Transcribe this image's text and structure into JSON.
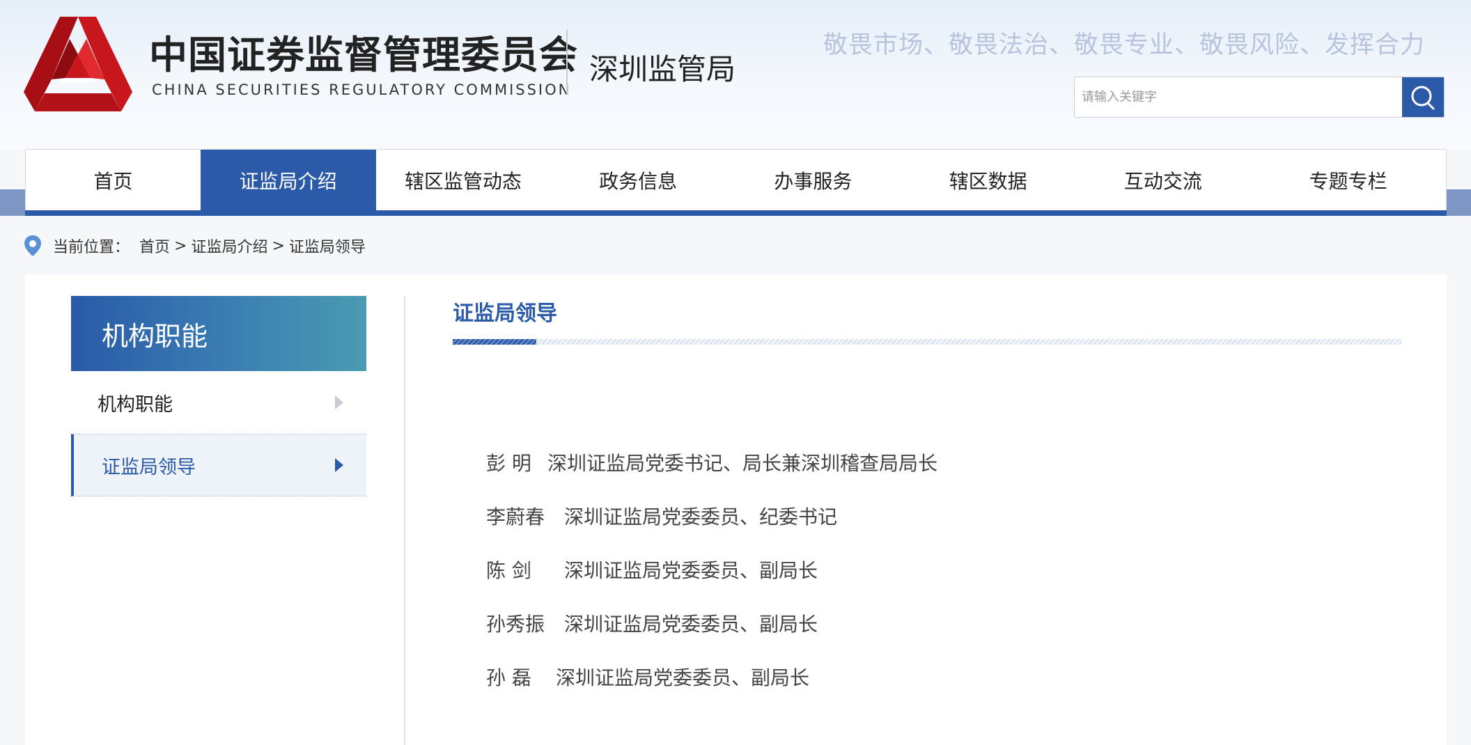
{
  "header": {
    "logo_cn": "中国证券监督管理委员会",
    "logo_en": "CHINA SECURITIES REGULATORY COMMISSION",
    "bureau": "深圳监管局",
    "slogan": "敬畏市场、敬畏法治、敬畏专业、敬畏风险、发挥合力",
    "search": {
      "placeholder": "请输入关键字",
      "value": "",
      "icon": "search-icon"
    }
  },
  "nav": {
    "items": [
      {
        "label": "首页"
      },
      {
        "label": "证监局介绍",
        "active": true
      },
      {
        "label": "辖区监管动态"
      },
      {
        "label": "政务信息"
      },
      {
        "label": "办事服务"
      },
      {
        "label": "辖区数据"
      },
      {
        "label": "互动交流"
      },
      {
        "label": "专题专栏"
      }
    ]
  },
  "breadcrumb": {
    "prefix": "当前位置：",
    "items": [
      "首页",
      "证监局介绍",
      "证监局领导"
    ],
    "separator": ">"
  },
  "sidebar": {
    "title": "机构职能",
    "items": [
      {
        "label": "机构职能",
        "active": false
      },
      {
        "label": "证监局领导",
        "active": true
      }
    ]
  },
  "content": {
    "title": "证监局领导",
    "leaders": [
      {
        "name": "彭  明",
        "position": "深圳证监局党委书记、局长兼深圳稽查局局长"
      },
      {
        "name": "李蔚春",
        "position": "深圳证监局党委委员、纪委书记"
      },
      {
        "name": "陈  剑",
        "position": "深圳证监局党委委员、副局长"
      },
      {
        "name": "孙秀振",
        "position": "深圳证监局党委委员、副局长"
      },
      {
        "name": "孙  磊",
        "position": "深圳证监局党委委员、副局长"
      }
    ]
  },
  "colors": {
    "primary": "#2a5aa8",
    "logo_red": "#c8161d",
    "slogan": "#b7c4dc"
  }
}
